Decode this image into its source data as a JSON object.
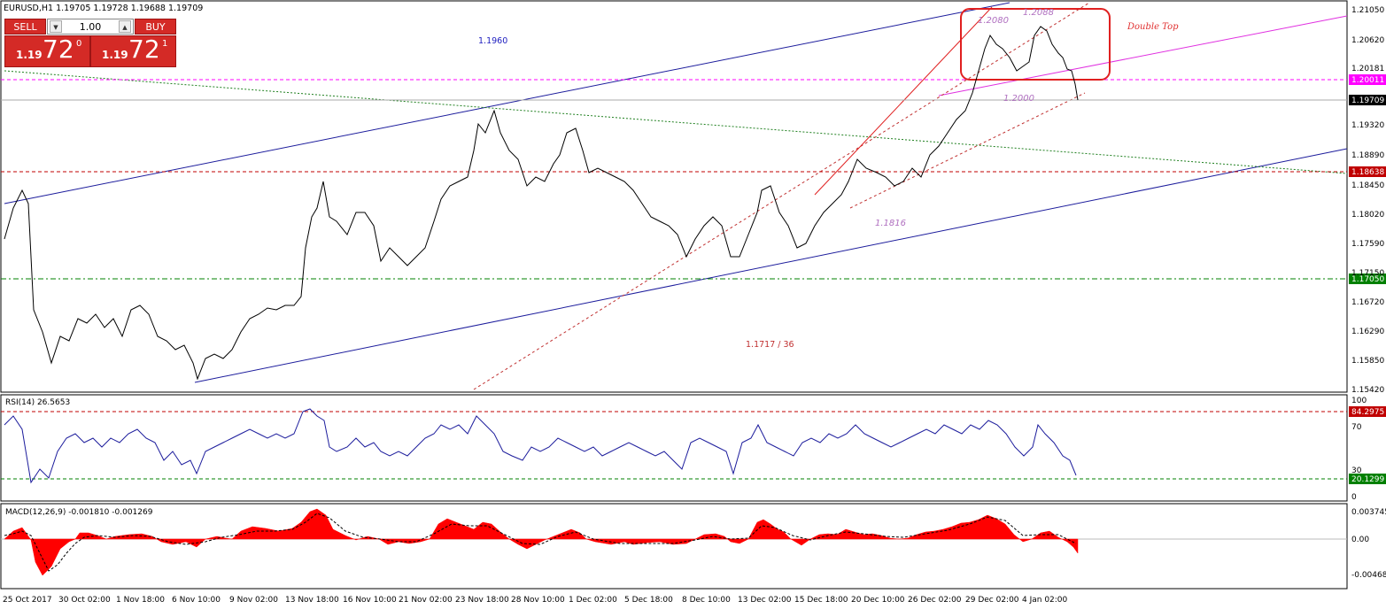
{
  "window": {
    "symbol_line": "EURUSD,H1  1.19705 1.19728 1.19688 1.19709"
  },
  "trade_panel": {
    "sell_label": "SELL",
    "buy_label": "BUY",
    "lot_value": "1.00",
    "sell_prefix": "1.19",
    "sell_big": "72",
    "sell_sup": "0",
    "buy_prefix": "1.19",
    "buy_big": "72",
    "buy_sup": "1"
  },
  "main_chart": {
    "price_axis": [
      "1.21050",
      "1.20620",
      "1.20181",
      "1.19709",
      "1.19320",
      "1.18890",
      "1.18638",
      "1.18450",
      "1.18020",
      "1.17590",
      "1.17150",
      "1.17050",
      "1.16720",
      "1.16290",
      "1.15850",
      "1.15420"
    ],
    "highlighted_levels": [
      {
        "label": "1.20011",
        "color": "#ff00ff"
      },
      {
        "label": "1.19709",
        "color": "#000000"
      },
      {
        "label": "1.18638",
        "color": "#c00000"
      },
      {
        "label": "1.17050",
        "color": "#008000"
      }
    ],
    "annotations": [
      {
        "text": "1.1960",
        "color": "#2020c0"
      },
      {
        "text": "1.2080",
        "color": "#b070c0"
      },
      {
        "text": "1.2088",
        "color": "#b070c0"
      },
      {
        "text": "Double Top",
        "color": "#e03030"
      },
      {
        "text": "1.2000",
        "color": "#b070c0"
      },
      {
        "text": "1.1816",
        "color": "#b070c0"
      },
      {
        "text": "1.1717 / 36",
        "color": "#c03030"
      }
    ]
  },
  "rsi": {
    "title": "RSI(14) 26.5653",
    "axis": [
      "100",
      "70",
      "30",
      "0"
    ],
    "levels": [
      {
        "label": "84.2975",
        "color": "#c00000"
      },
      {
        "label": "20.1299",
        "color": "#008000"
      }
    ]
  },
  "macd": {
    "title": "MACD(12,26,9) -0.001810 -0.001269",
    "axis": [
      "0.003745",
      "0.00",
      "-0.004682"
    ]
  },
  "time_axis": [
    "25 Oct 2017",
    "30 Oct 02:00",
    "1 Nov 18:00",
    "6 Nov 10:00",
    "9 Nov 02:00",
    "13 Nov 18:00",
    "16 Nov 10:00",
    "21 Nov 02:00",
    "23 Nov 18:00",
    "28 Nov 10:00",
    "1 Dec 02:00",
    "5 Dec 18:00",
    "8 Dec 10:00",
    "13 Dec 02:00",
    "15 Dec 18:00",
    "20 Dec 10:00",
    "26 Dec 02:00",
    "29 Dec 02:00",
    "4 Jan 02:00"
  ]
}
